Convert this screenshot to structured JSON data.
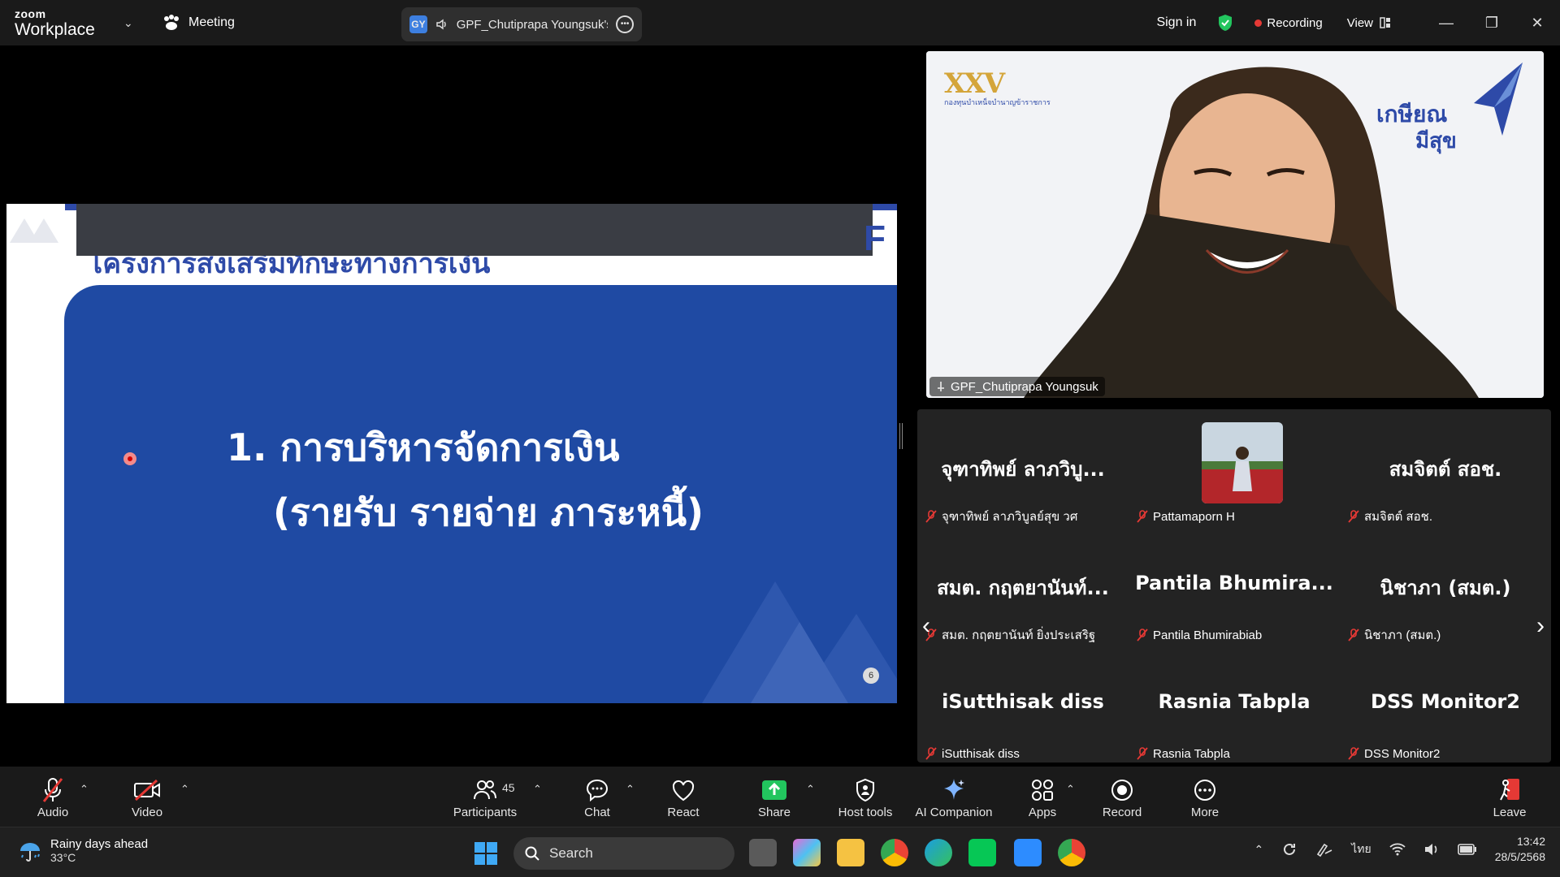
{
  "titlebar": {
    "brand_top": "zoom",
    "brand_bottom": "Workplace",
    "meeting_label": "Meeting",
    "speaker_badge": "GY",
    "speaker_name": "GPF_Chutiprapa Youngsuk's :",
    "sign_in": "Sign in",
    "recording": "Recording",
    "view": "View"
  },
  "slide": {
    "partial_title": "โครงการส่งเสริมทักษะทางการเงิน",
    "line1": "1. การบริหารจัดการเงิน",
    "line2": "(รายรับ รายจ่าย ภาระหนี้)",
    "page_number": "6",
    "logo_letter": "F"
  },
  "speaker_video": {
    "name": "GPF_Chutiprapa Youngsuk",
    "logo_left_mark": "XXV",
    "logo_left_sub": "กองทุนบำเหน็จบำนาญข้าราชการ",
    "logo_right_line1": "เกษียณ",
    "logo_right_line2": "มีสุข"
  },
  "gallery": {
    "tiles": [
      {
        "big": "จุฑาทิพย์  ลาภวิบู...",
        "small": "จุฑาทิพย์  ลาภวิบูลย์สุข วศ"
      },
      {
        "big": "",
        "small": "Pattamaporn H"
      },
      {
        "big": "สมจิตต์ สอช.",
        "small": "สมจิตต์ สอช."
      },
      {
        "big": "สมต. กฤตยานันท์...",
        "small": "สมต. กฤตยานันท์ ยิ่งประเสริฐ"
      },
      {
        "big": "Pantila  Bhumira...",
        "small": "Pantila Bhumirabiab"
      },
      {
        "big": "นิชาภา (สมต.)",
        "small": "นิชาภา (สมต.)"
      },
      {
        "big": "iSutthisak diss",
        "small": "iSutthisak diss"
      },
      {
        "big": "Rasnia Tabpla",
        "small": "Rasnia Tabpla"
      },
      {
        "big": "DSS Monitor2",
        "small": "DSS Monitor2"
      }
    ]
  },
  "toolbar": {
    "audio": "Audio",
    "video": "Video",
    "participants": "Participants",
    "participant_count": "45",
    "chat": "Chat",
    "react": "React",
    "share": "Share",
    "host_tools": "Host tools",
    "ai_companion": "AI Companion",
    "apps": "Apps",
    "record": "Record",
    "more": "More",
    "leave": "Leave"
  },
  "taskbar": {
    "weather_title": "Rainy days ahead",
    "weather_temp": "33°C",
    "search": "Search",
    "language": "ไทย",
    "time": "13:42",
    "date": "28/5/2568"
  },
  "colors": {
    "slide_blue": "#1f4aa3",
    "recording_red": "#e53935",
    "share_green": "#22c55e",
    "leave_red": "#e53935"
  }
}
